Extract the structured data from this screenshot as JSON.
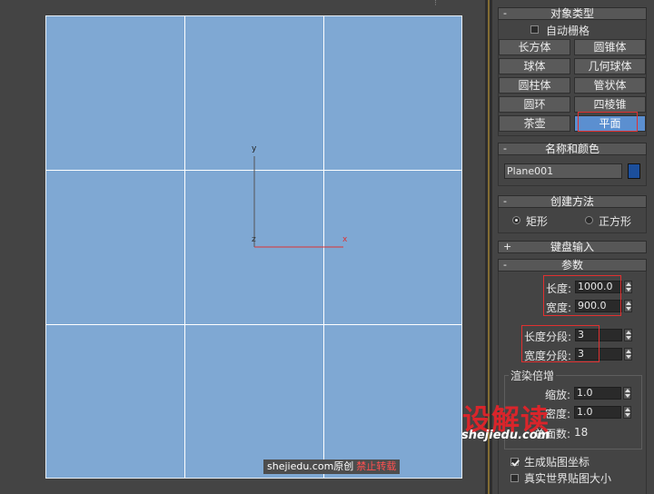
{
  "viewport": {
    "axis_y": "y",
    "axis_x": "x",
    "axis_z": "z",
    "watermark_site": "shejiedu.com",
    "watermark_orig": "原创",
    "watermark_forbid": "禁止转载",
    "corner_marks": "⁝"
  },
  "object_type": {
    "title": "对象类型",
    "sign": "-",
    "autogrid_label": "自动栅格",
    "buttons": [
      "长方体",
      "圆锥体",
      "球体",
      "几何球体",
      "圆柱体",
      "管状体",
      "圆环",
      "四棱锥",
      "茶壶",
      "平面"
    ],
    "active_button": "平面"
  },
  "name_color": {
    "title": "名称和颜色",
    "sign": "-",
    "name_value": "Plane001",
    "color": "#1c4f9c"
  },
  "creation_method": {
    "title": "创建方法",
    "sign": "-",
    "options": [
      "矩形",
      "正方形"
    ],
    "selected": "矩形"
  },
  "keyboard_entry": {
    "title": "键盘输入",
    "sign": "+"
  },
  "parameters": {
    "title": "参数",
    "sign": "-",
    "length_label": "长度:",
    "length_value": "1000.0",
    "width_label": "宽度:",
    "width_value": "900.0",
    "length_segs_label": "长度分段:",
    "length_segs_value": "3",
    "width_segs_label": "宽度分段:",
    "width_segs_value": "3",
    "render_group_title": "渲染倍增",
    "scale_label": "缩放:",
    "scale_value": "1.0",
    "density_label": "密度:",
    "density_value": "1.0",
    "total_faces_label": "总面数:",
    "total_faces_value": "18",
    "gen_mapping_label": "生成贴图坐标",
    "real_world_label": "真实世界贴图大小"
  },
  "watermark": {
    "logo": "设解读",
    "url": "shejiedu.com"
  },
  "colors": {
    "plane": "#7fa8d3",
    "active_button": "#5b8fd0",
    "highlight_box": "#e03030"
  }
}
